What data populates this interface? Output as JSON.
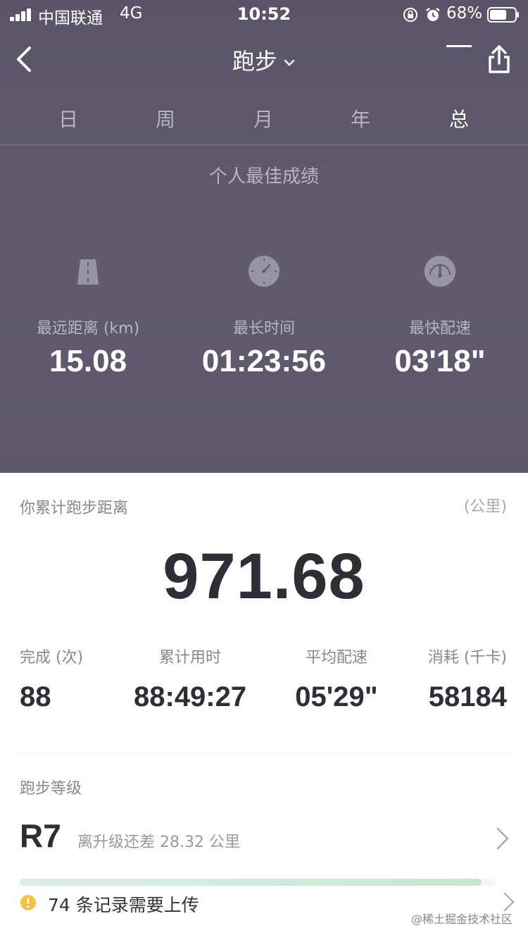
{
  "status_bar": {
    "carrier": "中国联通",
    "network": "4G",
    "time": "10:52",
    "battery_percent": "68%",
    "battery_level": 0.68
  },
  "nav": {
    "title": "跑步",
    "back_icon": "chevron-left-icon",
    "share_icon": "share-icon"
  },
  "tabs": [
    {
      "label": "日",
      "active": false
    },
    {
      "label": "周",
      "active": false
    },
    {
      "label": "月",
      "active": false
    },
    {
      "label": "年",
      "active": false
    },
    {
      "label": "总",
      "active": true
    }
  ],
  "personal_best": {
    "title": "个人最佳成绩",
    "items": [
      {
        "icon": "road-icon",
        "label": "最远距离 (km)",
        "value": "15.08"
      },
      {
        "icon": "stopwatch-icon",
        "label": "最长时间",
        "value": "01:23:56"
      },
      {
        "icon": "speedometer-icon",
        "label": "最快配速",
        "value": "03'18\""
      }
    ]
  },
  "total": {
    "label": "你累计跑步距离",
    "unit": "(公里)",
    "value": "971.68"
  },
  "stats": [
    {
      "label": "完成 (次)",
      "value": "88"
    },
    {
      "label": "累计用时",
      "value": "88:49:27"
    },
    {
      "label": "平均配速",
      "value": "05'29\""
    },
    {
      "label": "消耗 (千卡)",
      "value": "58184"
    }
  ],
  "level": {
    "title": "跑步等级",
    "code": "R7",
    "description": "离升级还差 28.32 公里",
    "progress": 0.97
  },
  "upload": {
    "text": "74 条记录需要上传",
    "icon": "warning-icon"
  },
  "watermark": "@稀土掘金技术社区",
  "colors": {
    "header_bg": "#5f586c",
    "text_dark": "#2f2e37",
    "progress": "#c4e7d2",
    "warning": "#f5c242"
  }
}
